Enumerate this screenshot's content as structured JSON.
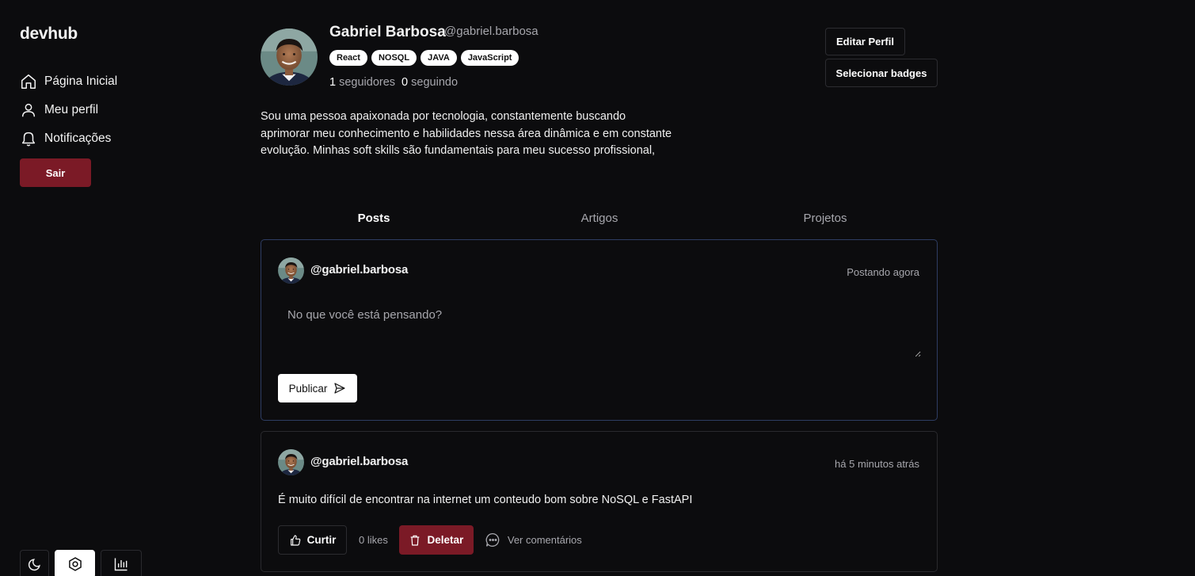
{
  "app": {
    "logo": "devhub"
  },
  "sidebar": {
    "items": [
      {
        "label": "Página Inicial",
        "icon": "home-icon"
      },
      {
        "label": "Meu perfil",
        "icon": "user-icon"
      },
      {
        "label": "Notificações",
        "icon": "bell-icon"
      }
    ],
    "logout_label": "Sair",
    "dock": [
      {
        "icon": "moon-icon",
        "active": false
      },
      {
        "icon": "hexagon-icon",
        "active": true
      },
      {
        "icon": "bar-chart-icon",
        "active": false
      }
    ]
  },
  "profile": {
    "name": "Gabriel Barbosa",
    "handle": "@gabriel.barbosa",
    "badges": [
      "React",
      "NOSQL",
      "JAVA",
      "JavaScript"
    ],
    "followers_count": "1",
    "followers_label": "seguidores",
    "following_count": "0",
    "following_label": "seguindo",
    "bio": "Sou uma pessoa apaixonada por tecnologia, constantemente buscando aprimorar meu conhecimento e habilidades nessa área dinâmica e em constante evolução. Minhas soft skills são fundamentais para meu sucesso profissional,",
    "edit_label": "Editar Perfil",
    "select_badges_label": "Selecionar badges"
  },
  "tabs": [
    {
      "label": "Posts",
      "active": true
    },
    {
      "label": "Artigos",
      "active": false
    },
    {
      "label": "Projetos",
      "active": false
    }
  ],
  "composer": {
    "user": "@gabriel.barbosa",
    "status": "Postando agora",
    "placeholder": "No que você está pensando?",
    "value": "",
    "publish_label": "Publicar"
  },
  "posts": [
    {
      "user": "@gabriel.barbosa",
      "time": "há 5 minutos atrás",
      "text": "É muito difícil de encontrar na internet um conteudo bom sobre NoSQL e FastAPI",
      "like_label": "Curtir",
      "likes": "0 likes",
      "delete_label": "Deletar",
      "comments_label": "Ver comentários"
    }
  ],
  "colors": {
    "background": "#0c0c0e",
    "accent": "#7b1a26",
    "border": "#2a2a2e",
    "composer_border": "#2e3d63",
    "muted_text": "#a7a7ad"
  }
}
